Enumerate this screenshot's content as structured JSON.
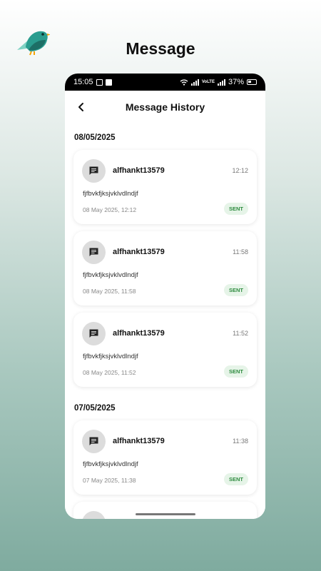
{
  "promo": {
    "title": "Message"
  },
  "statusbar": {
    "time": "15:05",
    "battery": "37%",
    "network": "VoLTE"
  },
  "appbar": {
    "title": "Message History"
  },
  "groups": [
    {
      "date": "08/05/2025",
      "messages": [
        {
          "sender": "alfhankt13579",
          "time": "12:12",
          "body": "fjfbvkfjksjvklvdlndjf",
          "timestamp": "08 May 2025, 12:12",
          "status": "SENT"
        },
        {
          "sender": "alfhankt13579",
          "time": "11:58",
          "body": "fjfbvkfjksjvklvdlndjf",
          "timestamp": "08 May 2025, 11:58",
          "status": "SENT"
        },
        {
          "sender": "alfhankt13579",
          "time": "11:52",
          "body": "fjfbvkfjksjvklvdlndjf",
          "timestamp": "08 May 2025, 11:52",
          "status": "SENT"
        }
      ]
    },
    {
      "date": "07/05/2025",
      "messages": [
        {
          "sender": "alfhankt13579",
          "time": "11:38",
          "body": "fjfbvkfjksjvklvdlndjf",
          "timestamp": "07 May 2025, 11:38",
          "status": "SENT"
        }
      ]
    }
  ],
  "colors": {
    "accent": "#2e8b3f",
    "badge_bg": "#e6f4e8",
    "avatar_bg": "#dcdcdc",
    "logo_teal": "#2a9d8f",
    "logo_dark": "#1d6f66",
    "logo_beak": "#f4a300"
  },
  "icons": {
    "logo": "bird-logo",
    "back": "arrow-back-icon",
    "avatar": "message-icon"
  }
}
